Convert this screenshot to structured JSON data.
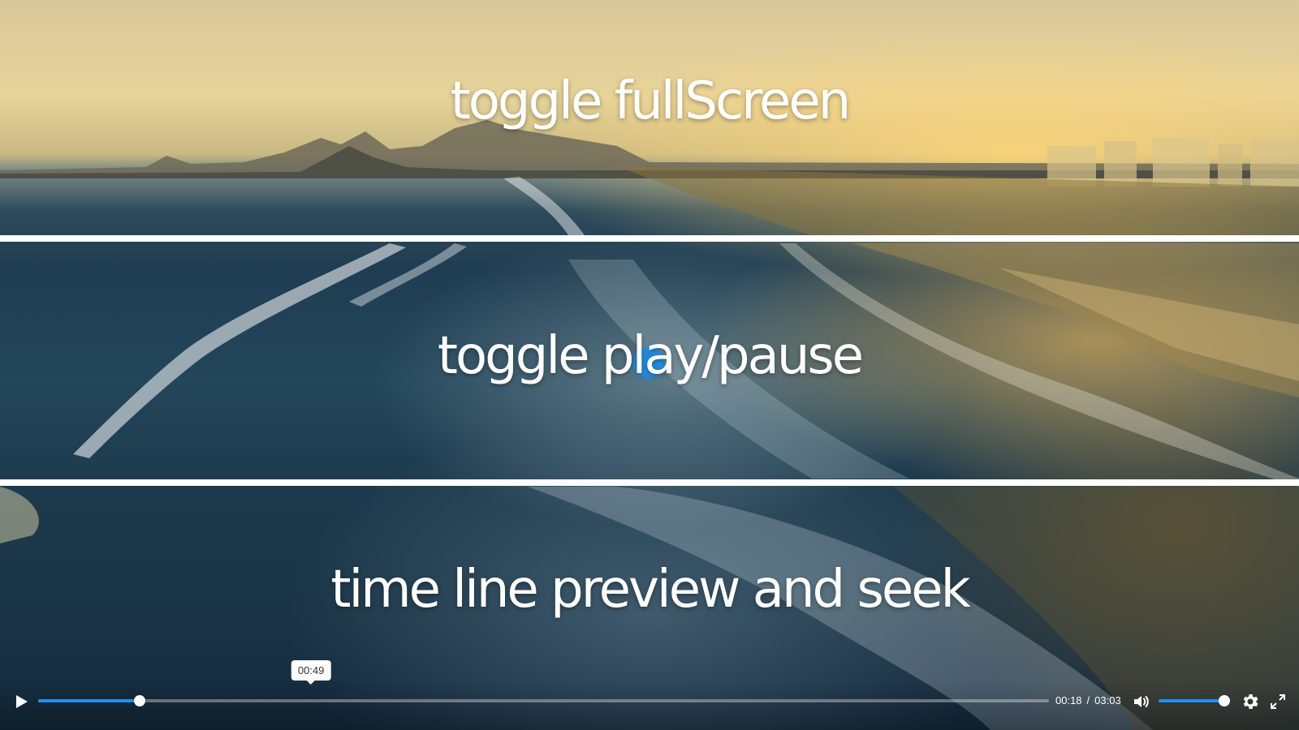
{
  "overlay": {
    "fullscreen_hint": "toggle fullScreen",
    "playpause_hint": "toggle play/pause",
    "seek_hint": "time line preview and seek"
  },
  "controls": {
    "play_icon": "play-icon",
    "preview_time": "00:49",
    "current_time": "00:18",
    "separator": "/",
    "duration": "03:03",
    "progress_fraction": 0.1,
    "preview_fraction": 0.27,
    "volume_icon": "volume-icon",
    "volume_level": 0.96,
    "settings_icon": "gear-icon",
    "fullscreen_icon": "fullscreen-icon"
  },
  "colors": {
    "accent": "#1e90f0",
    "text": "#ffffff"
  }
}
